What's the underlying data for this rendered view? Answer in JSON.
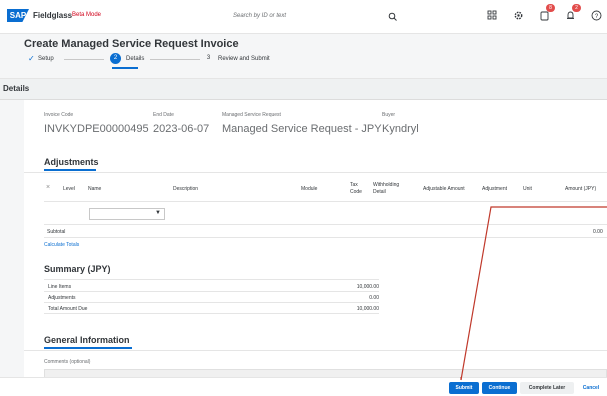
{
  "shell": {
    "logo": "SAP",
    "brand": "Fieldglass",
    "beta": "Beta Mode",
    "search_placeholder": "Search by ID or text",
    "badges": {
      "notifications": "8",
      "messages": "2"
    }
  },
  "page": {
    "title": "Create Managed Service Request Invoice"
  },
  "stepper": {
    "steps": [
      {
        "label": "Setup",
        "marker": "✓"
      },
      {
        "label": "Details",
        "marker": "2"
      },
      {
        "label": "Review and Submit",
        "marker": "3"
      }
    ]
  },
  "details": {
    "band_title": "Details",
    "fields": [
      {
        "label": "Invoice Code",
        "value": "INVKYDPE00000495"
      },
      {
        "label": "End Date",
        "value": "2023-06-07"
      },
      {
        "label": "Managed Service Request",
        "value": "Managed Service Request - JPY"
      },
      {
        "label": "Buyer",
        "value": "Kyndryl"
      }
    ]
  },
  "adjustments": {
    "title": "Adjustments",
    "close_glyph": "×",
    "columns": {
      "level": "Level",
      "name": "Name",
      "description": "Description",
      "module": "Module",
      "tax_code": "Tax Code",
      "withholding": "Withholding Detail",
      "adjustable_amount": "Adjustable Amount",
      "adjustment": "Adjustment",
      "unit": "Unit",
      "amount": "Amount (JPY)"
    },
    "subtotal_label": "Subtotal",
    "subtotal_value": "0.00",
    "calculate_link": "Calculate Totals"
  },
  "summary": {
    "title": "Summary (JPY)",
    "rows": [
      {
        "label": "Line Items",
        "value": "10,000.00"
      },
      {
        "label": "Adjustments",
        "value": "0.00"
      },
      {
        "label": "Total Amount Due",
        "value": "10,000.00"
      }
    ]
  },
  "general": {
    "title": "General Information",
    "comments_label": "Comments (optional)"
  },
  "footer": {
    "submit": "Submit",
    "continue": "Continue",
    "complete_later": "Complete Later",
    "cancel": "Cancel"
  },
  "colors": {
    "accent": "#0a6ed1",
    "annotation": "#c0392b",
    "badge": "#e24c4b"
  },
  "icons": [
    "search-icon",
    "grid-icon",
    "gear-icon",
    "notification-icon",
    "bell-icon",
    "help-icon",
    "chevron-down-icon",
    "check-icon",
    "close-icon"
  ]
}
